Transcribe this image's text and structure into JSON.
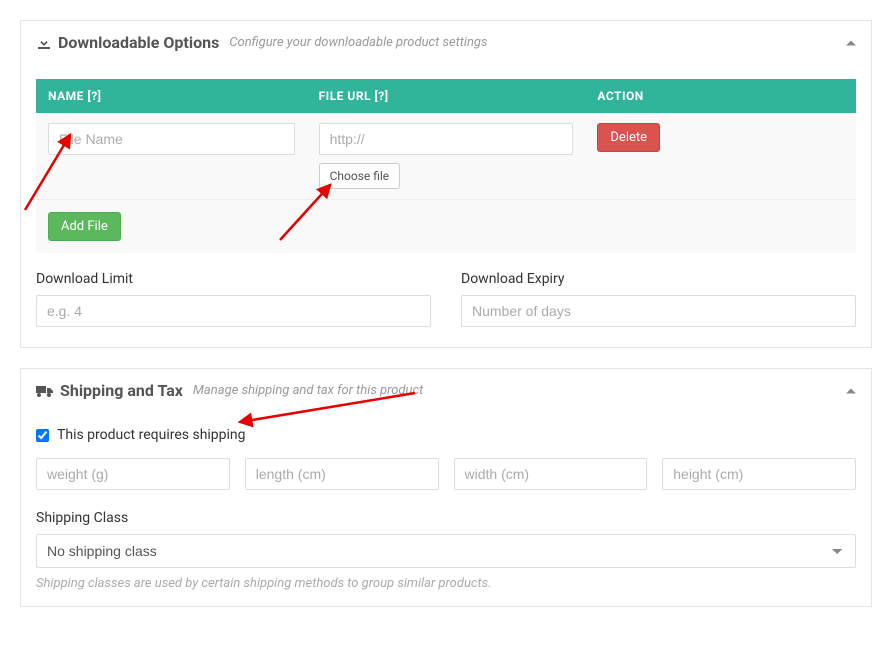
{
  "downloadable": {
    "title": "Downloadable Options",
    "subtitle": "Configure your downloadable product settings",
    "table": {
      "headers": {
        "name": "NAME [?]",
        "url": "FILE URL [?]",
        "action": "ACTION"
      },
      "row": {
        "name_placeholder": "File Name",
        "url_placeholder": "http://",
        "choose_label": "Choose file",
        "delete_label": "Delete"
      },
      "add_label": "Add File"
    },
    "download_limit": {
      "label": "Download Limit",
      "placeholder": "e.g. 4"
    },
    "download_expiry": {
      "label": "Download Expiry",
      "placeholder": "Number of days"
    }
  },
  "shipping": {
    "title": "Shipping and Tax",
    "subtitle": "Manage shipping and tax for this product",
    "requires_label": "This product requires shipping",
    "requires_checked": true,
    "dims": {
      "weight_placeholder": "weight (g)",
      "length_placeholder": "length (cm)",
      "width_placeholder": "width (cm)",
      "height_placeholder": "height (cm)"
    },
    "shipping_class": {
      "label": "Shipping Class",
      "selected": "No shipping class",
      "help": "Shipping classes are used by certain shipping methods to group similar products."
    }
  }
}
